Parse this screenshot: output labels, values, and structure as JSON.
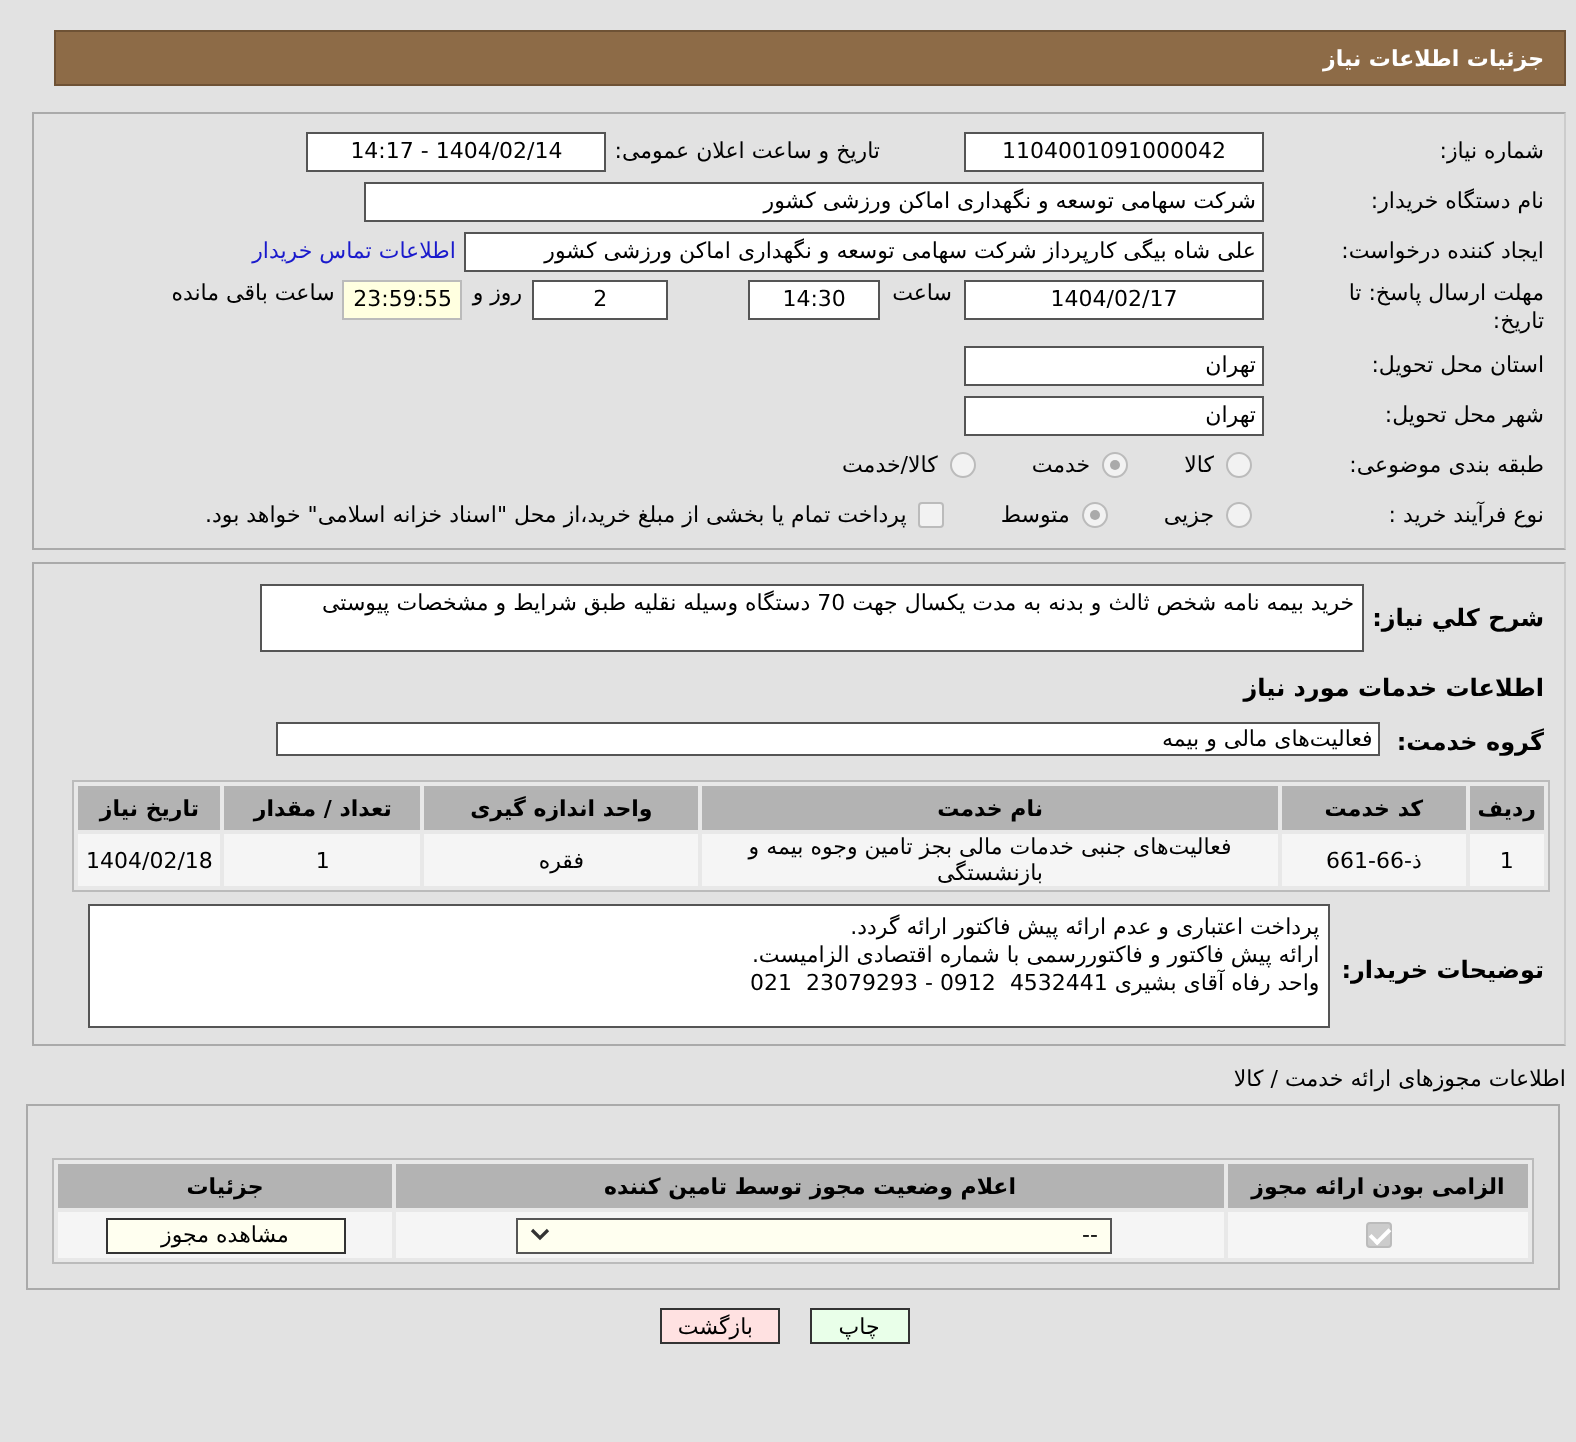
{
  "header": {
    "title": "جزئیات اطلاعات نیاز"
  },
  "need_number": {
    "label": "شماره نیاز:",
    "value": "1104001091000042"
  },
  "announce": {
    "label": "تاریخ و ساعت اعلان عمومی:",
    "value": "1404/02/14 - 14:17"
  },
  "buyer": {
    "label": "نام دستگاه خریدار:",
    "value": "شرکت سهامی توسعه و نگهداری اماکن ورزشی کشور"
  },
  "requester": {
    "label": "ایجاد کننده درخواست:",
    "value": "علی شاه بیگی کارپرداز شرکت سهامی توسعه و نگهداری اماکن ورزشی کشور",
    "link": "اطلاعات تماس خریدار"
  },
  "deadline": {
    "label": "مهلت ارسال پاسخ: تا تاریخ:",
    "date": "1404/02/17",
    "time_label": "ساعت",
    "time": "14:30",
    "days": "2",
    "days_label": "روز و",
    "remaining": "23:59:55",
    "remaining_label": "ساعت باقی مانده"
  },
  "province": {
    "label": "استان محل تحویل:",
    "value": "تهران"
  },
  "city": {
    "label": "شهر محل تحویل:",
    "value": "تهران"
  },
  "category": {
    "label": "طبقه بندی موضوعی:",
    "options": [
      {
        "label": "کالا",
        "selected": false
      },
      {
        "label": "خدمت",
        "selected": true
      },
      {
        "label": "کالا/خدمت",
        "selected": false
      }
    ]
  },
  "process": {
    "label": "نوع فرآیند خرید :",
    "options": [
      {
        "label": "جزیی",
        "selected": false
      },
      {
        "label": "متوسط",
        "selected": true
      }
    ],
    "payment": {
      "label": "پرداخت تمام یا بخشی از مبلغ خرید،از محل \"اسناد خزانه اسلامی\" خواهد بود.",
      "checked": false
    }
  },
  "summary": {
    "label": "شرح کلي نياز:",
    "value": "خرید بیمه نامه شخص ثالث و بدنه به مدت یکسال جهت 70 دستگاه وسیله نقلیه طبق شرایط و مشخصات پیوستی"
  },
  "services_title": "اطلاعات خدمات مورد نیاز",
  "service_group": {
    "label": "گروه خدمت:",
    "value": "فعالیت‌های مالی و بیمه"
  },
  "table": {
    "columns": [
      "ردیف",
      "کد خدمت",
      "نام خدمت",
      "واحد اندازه گیری",
      "تعداد / مقدار",
      "تاریخ نیاز"
    ],
    "rows": [
      [
        "1",
        "ذ-66-661",
        "فعالیت‌های جنبی خدمات مالی بجز تامین وجوه بیمه و بازنشستگی",
        "فقره",
        "1",
        "1404/02/18"
      ]
    ]
  },
  "buyer_notes": {
    "label": "توضیحات خریدار:",
    "lines": [
      "پرداخت اعتباری و عدم ارائه پیش فاکتور ارائه گردد.",
      "ارائه پیش فاکتور و فاکتوررسمی با شماره اقتصادی الزامیست.",
      "واحد رفاه آقای بشیری 4532441  0912 - 23079293  021"
    ]
  },
  "licenses": {
    "title": "اطلاعات مجوزهای ارائه خدمت / کالا",
    "columns": [
      "الزامی بودن ارائه مجوز",
      "اعلام وضعیت مجوز توسط تامین کننده",
      "جزئیات"
    ],
    "rows": [
      {
        "required": true,
        "status": "--",
        "details_button": "مشاهده مجوز"
      }
    ]
  },
  "buttons": [
    {
      "label": "چاپ",
      "kind": "print"
    },
    {
      "label": "بازگشت",
      "kind": "back"
    }
  ]
}
